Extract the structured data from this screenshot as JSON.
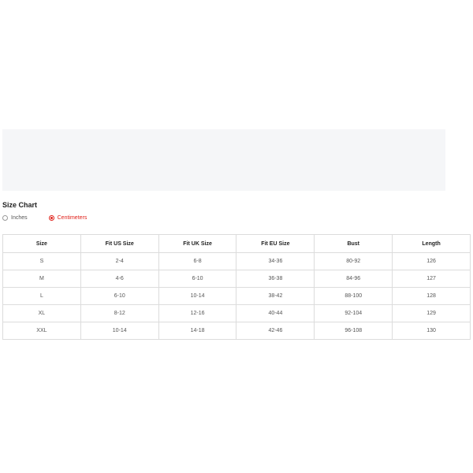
{
  "size_chart": {
    "title": "Size Chart",
    "units": [
      {
        "label": "Inches",
        "selected": false
      },
      {
        "label": "Centimeters",
        "selected": true
      }
    ],
    "accent_color": "#e0221b",
    "columns": [
      "Size",
      "Fit US Size",
      "Fit UK Size",
      "Fit EU Size",
      "Bust",
      "Length"
    ],
    "rows": [
      [
        "S",
        "2-4",
        "6-8",
        "34-36",
        "80-92",
        "126"
      ],
      [
        "M",
        "4-6",
        "6-10",
        "36-38",
        "84-96",
        "127"
      ],
      [
        "L",
        "6-10",
        "10-14",
        "38-42",
        "88-100",
        "128"
      ],
      [
        "XL",
        "8-12",
        "12-16",
        "40-44",
        "92-104",
        "129"
      ],
      [
        "XXL",
        "10-14",
        "14-18",
        "42-46",
        "96-108",
        "130"
      ]
    ]
  }
}
